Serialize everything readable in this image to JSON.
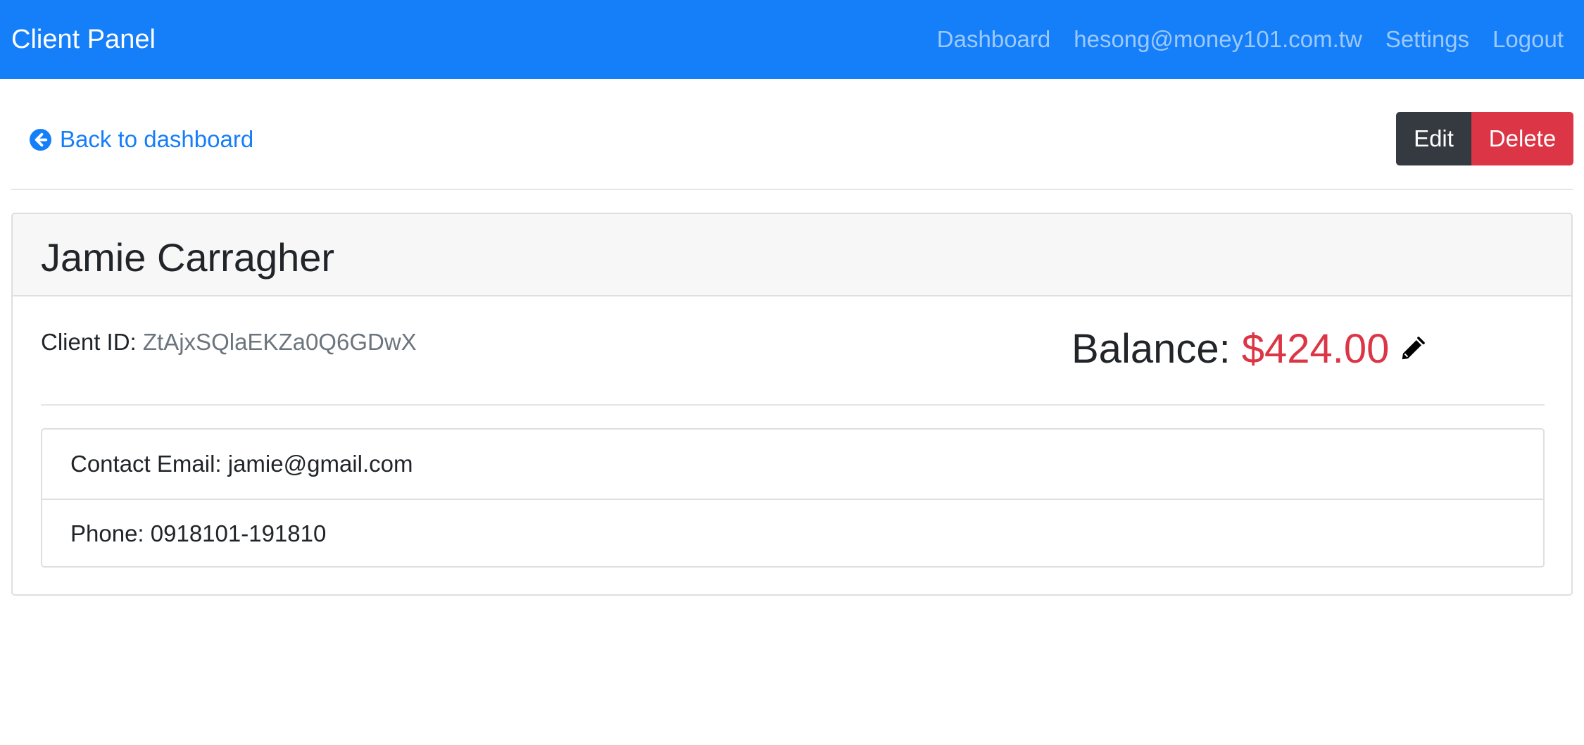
{
  "navbar": {
    "brand": "Client Panel",
    "links": [
      {
        "label": "Dashboard"
      },
      {
        "label": "hesong@money101.com.tw"
      },
      {
        "label": "Settings"
      },
      {
        "label": "Logout"
      }
    ],
    "background_color": "#157ef9"
  },
  "actions": {
    "back_label": "Back to dashboard",
    "back_icon": "arrow-circle-left-icon",
    "edit_label": "Edit",
    "delete_label": "Delete"
  },
  "client": {
    "name": "Jamie Carragher",
    "id_label": "Client ID:",
    "id_value": "ZtAjxSQlaEKZa0Q6GDwX",
    "balance_label": "Balance:",
    "balance_value": "$424.00",
    "balance_edit_icon": "pencil-icon",
    "contact_email": "Contact Email: jamie@gmail.com",
    "phone": "Phone: 0918101-191810"
  },
  "colors": {
    "primary": "#157ef9",
    "danger": "#dc3545",
    "dark": "#343a40",
    "muted": "#6c757d"
  }
}
